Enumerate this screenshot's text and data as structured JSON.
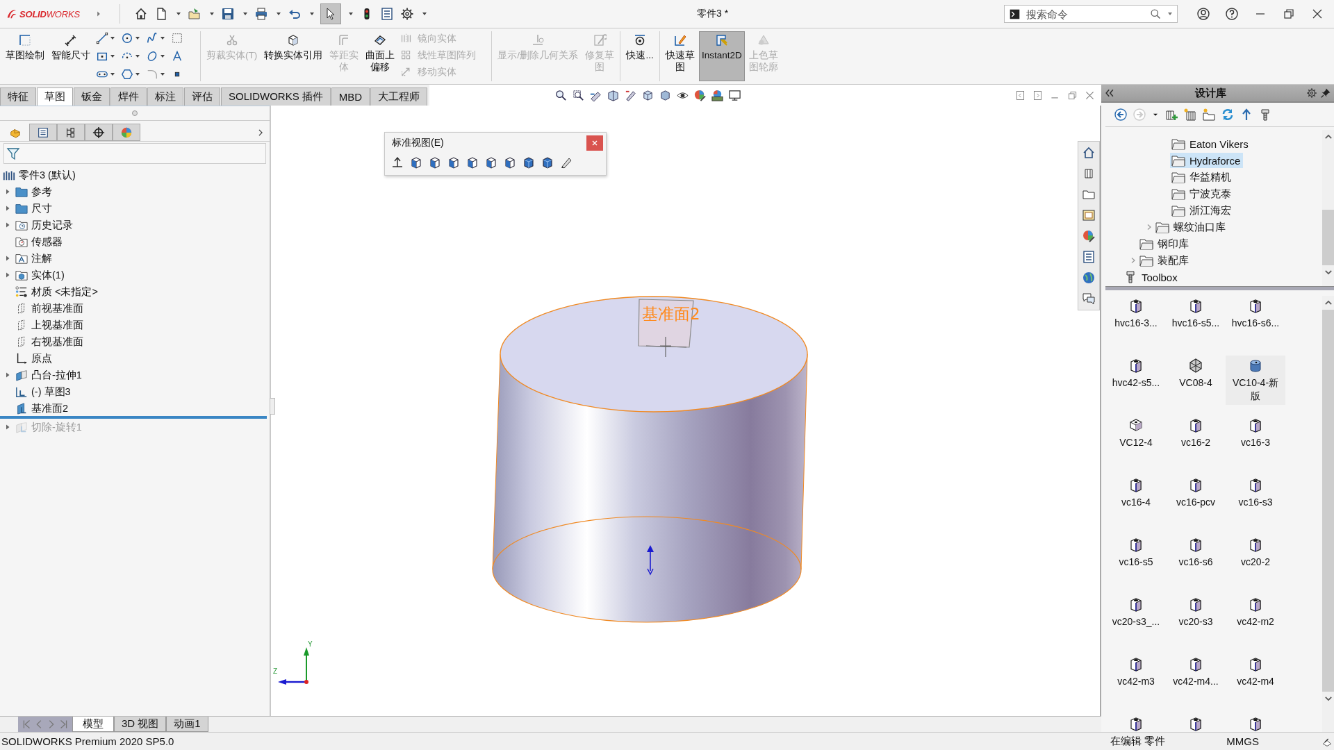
{
  "title_bar": {
    "app_name": "**SOLID**WORKS",
    "document_title": "零件3 *",
    "search": {
      "placeholder": "搜索命令"
    }
  },
  "ribbon": {
    "groups": [
      {
        "kind": "large",
        "buttons": [
          {
            "label": "草图绘制",
            "disabled": false,
            "pressed": false
          },
          {
            "label": "智能尺寸",
            "disabled": false,
            "pressed": false
          }
        ]
      },
      {
        "kind": "tools"
      },
      {
        "kind": "large",
        "buttons": [
          {
            "label": "剪裁实体(T)",
            "disabled": true,
            "pressed": false
          },
          {
            "label": "转换实体引用",
            "disabled": false,
            "pressed": false
          },
          {
            "label": "等距实体",
            "disabled": true,
            "pressed": false
          },
          {
            "label": "曲面上偏移",
            "disabled": false,
            "pressed": false
          }
        ]
      },
      {
        "kind": "small",
        "buttons": [
          {
            "label": "镜向实体",
            "disabled": true,
            "pressed": false
          },
          {
            "label": "线性草图阵列",
            "disabled": true,
            "pressed": false
          },
          {
            "label": "移动实体",
            "disabled": true,
            "pressed": false
          }
        ]
      },
      {
        "kind": "large",
        "buttons": [
          {
            "label": "显示/删除几何关系",
            "disabled": true,
            "pressed": false
          },
          {
            "label": "修复草图",
            "disabled": true,
            "pressed": false
          }
        ]
      },
      {
        "kind": "large",
        "buttons": [
          {
            "label": "快速...",
            "disabled": false,
            "pressed": false
          }
        ]
      },
      {
        "kind": "large",
        "buttons": [
          {
            "label": "快速草图",
            "disabled": false,
            "pressed": false
          },
          {
            "label": "Instant2D",
            "disabled": false,
            "pressed": true
          },
          {
            "label": "上色草图轮廓",
            "disabled": true,
            "pressed": false
          }
        ]
      }
    ]
  },
  "command_tabs": [
    {
      "label": "特征",
      "selected": false
    },
    {
      "label": "草图",
      "selected": true
    },
    {
      "label": "钣金",
      "selected": false
    },
    {
      "label": "焊件",
      "selected": false
    },
    {
      "label": "标注",
      "selected": false
    },
    {
      "label": "评估",
      "selected": false
    },
    {
      "label": "SOLIDWORKS 插件",
      "selected": false
    },
    {
      "label": "MBD",
      "selected": false
    },
    {
      "label": "大工程师",
      "selected": false
    }
  ],
  "left_panel": {
    "tabs": [
      {
        "kind": "feature",
        "selected": true
      },
      {
        "kind": "property",
        "selected": false
      },
      {
        "kind": "configuration",
        "selected": false
      },
      {
        "kind": "dimxpert",
        "selected": false
      },
      {
        "kind": "display",
        "selected": false
      }
    ],
    "tree": {
      "label": "零件3  (默认)",
      "kind": "part",
      "children": [
        {
          "label": "参考",
          "kind": "folder",
          "collapsed": true,
          "suppressed": false
        },
        {
          "label": "尺寸",
          "kind": "folder",
          "collapsed": true,
          "suppressed": false
        },
        {
          "label": "历史记录",
          "kind": "history",
          "collapsed": true,
          "suppressed": false
        },
        {
          "label": "传感器",
          "kind": "sensor",
          "collapsed": false,
          "suppressed": false
        },
        {
          "label": "注解",
          "kind": "annotation",
          "collapsed": true,
          "suppressed": false
        },
        {
          "label": "实体(1)",
          "kind": "solid",
          "collapsed": true,
          "suppressed": false
        },
        {
          "label": "材质 <未指定>",
          "kind": "material",
          "collapsed": false,
          "suppressed": false
        },
        {
          "label": "前视基准面",
          "kind": "plane",
          "collapsed": false,
          "suppressed": false
        },
        {
          "label": "上视基准面",
          "kind": "plane",
          "collapsed": false,
          "suppressed": false
        },
        {
          "label": "右视基准面",
          "kind": "plane",
          "collapsed": false,
          "suppressed": false
        },
        {
          "label": "原点",
          "kind": "origin",
          "collapsed": false,
          "suppressed": false
        },
        {
          "label": "凸台-拉伸1",
          "kind": "extrude",
          "collapsed": true,
          "suppressed": false
        },
        {
          "label": "(-) 草图3",
          "kind": "sketch",
          "collapsed": false,
          "suppressed": false
        },
        {
          "label": "基准面2",
          "kind": "refplane",
          "collapsed": false,
          "suppressed": false
        },
        {
          "label": "切除-旋转1",
          "kind": "cut",
          "collapsed": true,
          "suppressed": true
        }
      ]
    }
  },
  "viewport": {
    "view_popup": {
      "title": "标准视图(E)"
    },
    "model": {
      "plane_label": "基准面2"
    },
    "triad": {
      "labels": [
        "Y",
        "Z"
      ]
    }
  },
  "design_library": {
    "title": "设计库",
    "tree": [
      {
        "children": [
          {
            "children": [
              {
                "children": [
                  {
                    "label": "Eaton Vikers",
                    "kind": "folder",
                    "selected": false,
                    "collapsed": false
                  },
                  {
                    "label": "Hydraforce",
                    "kind": "folder",
                    "selected": true,
                    "collapsed": false
                  },
                  {
                    "label": "华益精机",
                    "kind": "folder",
                    "selected": false,
                    "collapsed": false
                  },
                  {
                    "label": "宁波克泰",
                    "kind": "folder",
                    "selected": false,
                    "collapsed": false
                  },
                  {
                    "label": "浙江海宏",
                    "kind": "folder",
                    "selected": false,
                    "collapsed": false
                  }
                ]
              },
              {
                "label": "螺纹油口库",
                "kind": "folder",
                "selected": false,
                "collapsed": true
              }
            ]
          },
          {
            "label": "钢印库",
            "kind": "folder",
            "selected": false,
            "collapsed": false
          },
          {
            "label": "装配库",
            "kind": "folder",
            "selected": false,
            "collapsed": true
          }
        ]
      },
      {
        "label": "Toolbox",
        "kind": "toolbox",
        "selected": false,
        "collapsed": false
      }
    ],
    "items": [
      {
        "label": "hvc16-3...",
        "kind": "valve",
        "highlighted": false
      },
      {
        "label": "hvc16-s5...",
        "kind": "valve",
        "highlighted": false
      },
      {
        "label": "hvc16-s6...",
        "kind": "valve",
        "highlighted": false
      },
      {
        "label": "hvc42-s5...",
        "kind": "valve",
        "highlighted": false
      },
      {
        "label": "VC08-4",
        "kind": "cross",
        "highlighted": false
      },
      {
        "label": "VC10-4-新版",
        "kind": "cylinder",
        "highlighted": true
      },
      {
        "label": "VC12-4",
        "kind": "cube",
        "highlighted": false
      },
      {
        "label": "vc16-2",
        "kind": "valve",
        "highlighted": false
      },
      {
        "label": "vc16-3",
        "kind": "valve",
        "highlighted": false
      },
      {
        "label": "vc16-4",
        "kind": "valve",
        "highlighted": false
      },
      {
        "label": "vc16-pcv",
        "kind": "valve",
        "highlighted": false
      },
      {
        "label": "vc16-s3",
        "kind": "valve",
        "highlighted": false
      },
      {
        "label": "vc16-s5",
        "kind": "valve",
        "highlighted": false
      },
      {
        "label": "vc16-s6",
        "kind": "valve",
        "highlighted": false
      },
      {
        "label": "vc20-2",
        "kind": "valve",
        "highlighted": false
      },
      {
        "label": "vc20-s3_...",
        "kind": "valve",
        "highlighted": false
      },
      {
        "label": "vc20-s3",
        "kind": "valve",
        "highlighted": false
      },
      {
        "label": "vc42-m2",
        "kind": "valve",
        "highlighted": false
      },
      {
        "label": "vc42-m3",
        "kind": "valve",
        "highlighted": false
      },
      {
        "label": "vc42-m4...",
        "kind": "valve",
        "highlighted": false
      },
      {
        "label": "vc42-m4",
        "kind": "valve",
        "highlighted": false
      },
      {
        "kind": "valve",
        "highlighted": false
      },
      {
        "kind": "valve",
        "highlighted": false
      },
      {
        "kind": "valve",
        "highlighted": false
      }
    ]
  },
  "bottom_tabs": [
    {
      "label": "模型",
      "selected": true
    },
    {
      "label": "3D 视图",
      "selected": false
    },
    {
      "label": "动画1",
      "selected": false
    }
  ],
  "status_bar": {
    "product": "SOLIDWORKS Premium 2020 SP5.0",
    "mode": "在编辑 零件",
    "units": "MMGS"
  }
}
